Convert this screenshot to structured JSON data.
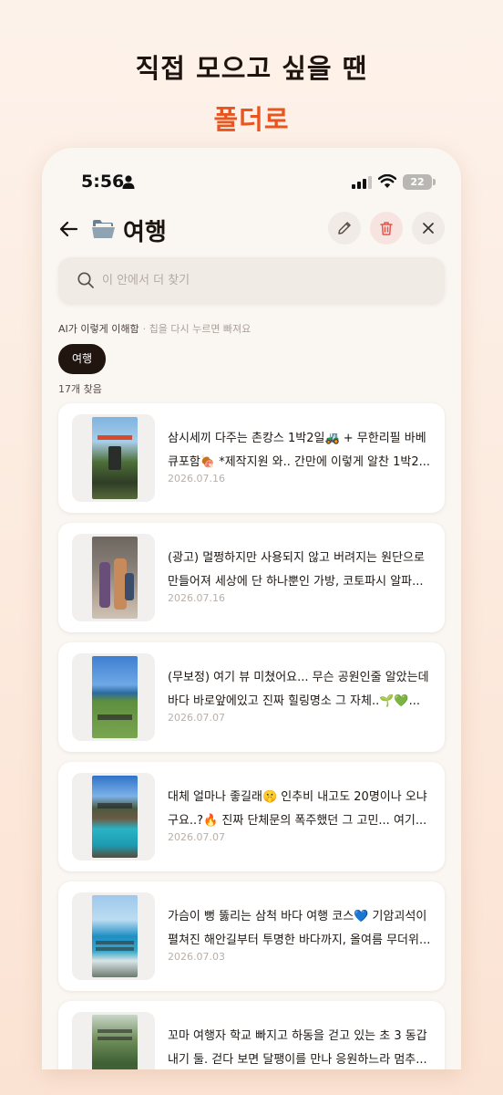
{
  "promo": {
    "line1": "직접 모으고 싶을 땐",
    "line2": "폴더로"
  },
  "status": {
    "time": "5:56",
    "battery": "22"
  },
  "header": {
    "title": "여행"
  },
  "search": {
    "placeholder": "이 안에서 더 찾기"
  },
  "ai": {
    "label": "AI가 이렇게 이해함",
    "hint": "· 칩을 다시 누르면 빠져요"
  },
  "chip": {
    "label": "여행"
  },
  "result_count": "17개 찾음",
  "cards": [
    {
      "title": "삼시세끼 다주는 촌캉스 1박2일🚜 + 무한리필 바베큐포함🍖 *제작지원 와.. 간만에 이렇게 알찬 1박2...",
      "date": "2026.07.16"
    },
    {
      "title": "(광고) 멀쩡하지만 사용되지 않고 버려지는 원단으로 만들어져 세상에 단 하나뿐인 가방, 코토파시 알파...",
      "date": "2026.07.16"
    },
    {
      "title": "(무보정) 여기 뷰 미쳤어요... 무슨 공원인줄 알았는데 바다 바로앞에있고 진짜 힐링명소 그 자체..🌱💚...",
      "date": "2026.07.07"
    },
    {
      "title": "대체 얼마나 좋길래🤫 인추비 내고도 20명이나 오냐구요..?🔥 진짜 단체문의 폭주했던 그 고민... 여기...",
      "date": "2026.07.07"
    },
    {
      "title": "가슴이 뻥 뚫리는 삼척 바다 여행 코스💙 기암괴석이 펼쳐진 해안길부터 투명한 바다까지, 올여름 무더위...",
      "date": "2026.07.03"
    },
    {
      "title": "꼬마 여행자 학교 빠지고 하동을 걷고 있는 초 3 동갑내기 둘. 걷다 보면 달팽이를 만나 응원하느라 멈추...",
      "date": ""
    }
  ]
}
